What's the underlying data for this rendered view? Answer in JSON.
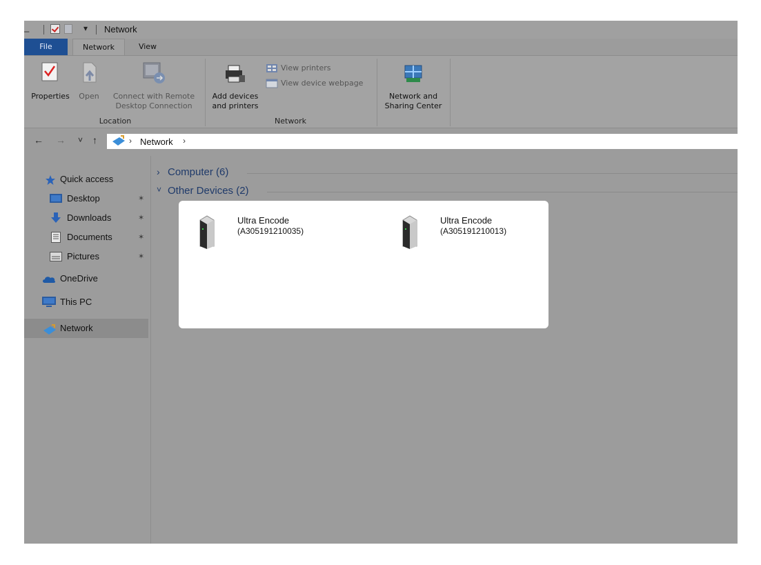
{
  "window": {
    "title": "Network",
    "minimize_glyph": "_",
    "dropdown_glyph": "▾"
  },
  "tabs": [
    {
      "label": "File"
    },
    {
      "label": "Network"
    },
    {
      "label": "View"
    }
  ],
  "ribbon": {
    "location_group": {
      "label": "Location",
      "properties": "Properties",
      "open": "Open",
      "connect_remote_line1": "Connect with Remote",
      "connect_remote_line2": "Desktop Connection"
    },
    "network_group": {
      "label": "Network",
      "add_devices_line1": "Add devices",
      "add_devices_line2": "and printers",
      "view_printers": "View printers",
      "view_device_webpage": "View device webpage"
    },
    "sharing": {
      "line1": "Network and",
      "line2": "Sharing Center"
    }
  },
  "address": {
    "back": "←",
    "forward": "→",
    "recent": "˅",
    "up": "↑",
    "path": "Network",
    "sep": "›"
  },
  "sidebar": {
    "items": [
      {
        "label": "Quick access",
        "icon": "star-icon"
      },
      {
        "label": "Desktop",
        "icon": "desktop-icon",
        "pinned": true
      },
      {
        "label": "Downloads",
        "icon": "downloads-icon",
        "pinned": true
      },
      {
        "label": "Documents",
        "icon": "documents-icon",
        "pinned": true
      },
      {
        "label": "Pictures",
        "icon": "pictures-icon",
        "pinned": true
      },
      {
        "label": "OneDrive",
        "icon": "cloud-icon"
      },
      {
        "label": "This PC",
        "icon": "pc-icon"
      },
      {
        "label": "Network",
        "icon": "network-icon",
        "selected": true
      }
    ],
    "pin_glyph": "✶"
  },
  "content": {
    "groups": [
      {
        "label": "Computer (6)",
        "expanded": false,
        "chevron": "›"
      },
      {
        "label": "Other Devices (2)",
        "expanded": true,
        "chevron": "˅"
      }
    ],
    "devices": [
      {
        "name": "Ultra Encode",
        "id": "(A305191210035)"
      },
      {
        "name": "Ultra Encode",
        "id": "(A305191210013)"
      }
    ]
  },
  "colors": {
    "file_tab": "#1e4f93",
    "window_bg": "#9c9c9c",
    "group_header": "#1f3a6a"
  }
}
